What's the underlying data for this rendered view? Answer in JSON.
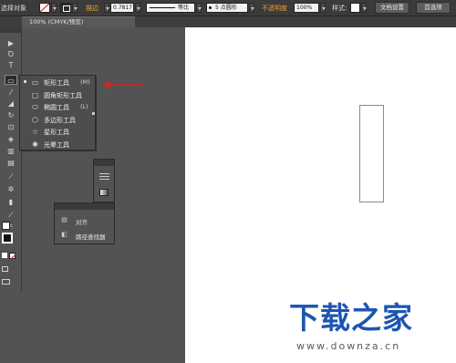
{
  "controlbar": {
    "mode_label": "选择对象",
    "stroke_label": "描边",
    "stroke_value": "0.7817",
    "line_style": "等比",
    "brush": "5 点圆形",
    "opacity_label": "不透明度",
    "opacity_value": "100%",
    "style_label": "样式:",
    "doc_setup": "文档设置",
    "preferences": "首选项"
  },
  "tab": {
    "title": "100% (CMYK/预览)"
  },
  "tools": [
    {
      "icon": "selection-icon",
      "glyph": "▶"
    },
    {
      "icon": "lasso-icon",
      "glyph": "Ꝺ"
    },
    {
      "icon": "type-icon",
      "glyph": "T"
    },
    {
      "icon": "rectangle-tool-icon",
      "glyph": "▭"
    },
    {
      "icon": "brush-icon",
      "glyph": "⁄"
    },
    {
      "icon": "eraser-icon",
      "glyph": "◢"
    },
    {
      "icon": "rotate-icon",
      "glyph": "↻"
    },
    {
      "icon": "free-transform-icon",
      "glyph": "⊡"
    },
    {
      "icon": "shape-builder-icon",
      "glyph": "◈"
    },
    {
      "icon": "graph-icon",
      "glyph": "▥"
    },
    {
      "icon": "gradient-icon",
      "glyph": "▤"
    },
    {
      "icon": "eyedropper-icon",
      "glyph": "⟋"
    },
    {
      "icon": "symbol-sprayer-icon",
      "glyph": "✲"
    },
    {
      "icon": "column-graph-icon",
      "glyph": "▮"
    },
    {
      "icon": "slice-icon",
      "glyph": "⟋"
    },
    {
      "icon": "zoom-icon",
      "glyph": "⌕"
    }
  ],
  "flyout": {
    "items": [
      {
        "label": "矩形工具",
        "shortcut": "(M)",
        "icon": "rectangle-icon",
        "glyph": "▭",
        "selected": true
      },
      {
        "label": "圆角矩形工具",
        "shortcut": "",
        "icon": "rounded-rectangle-icon",
        "glyph": "▢",
        "selected": false
      },
      {
        "label": "椭圆工具",
        "shortcut": "(L)",
        "icon": "ellipse-icon",
        "glyph": "⬭",
        "selected": false
      },
      {
        "label": "多边形工具",
        "shortcut": "",
        "icon": "polygon-icon",
        "glyph": "⬡",
        "selected": false
      },
      {
        "label": "星形工具",
        "shortcut": "",
        "icon": "star-icon",
        "glyph": "☆",
        "selected": false
      },
      {
        "label": "光晕工具",
        "shortcut": "",
        "icon": "flare-icon",
        "glyph": "✺",
        "selected": false
      }
    ]
  },
  "align_panel": {
    "items": [
      {
        "label": "对齐",
        "icon": "align-icon",
        "glyph": "▤"
      },
      {
        "label": "路径查找器",
        "icon": "pathfinder-icon",
        "glyph": "◧"
      }
    ]
  },
  "watermark": {
    "title": "下载之家",
    "url": "www.downza.cn"
  },
  "colors": {
    "annotation_arrow": "#e02020",
    "watermark_blue": "#1e55b3"
  }
}
